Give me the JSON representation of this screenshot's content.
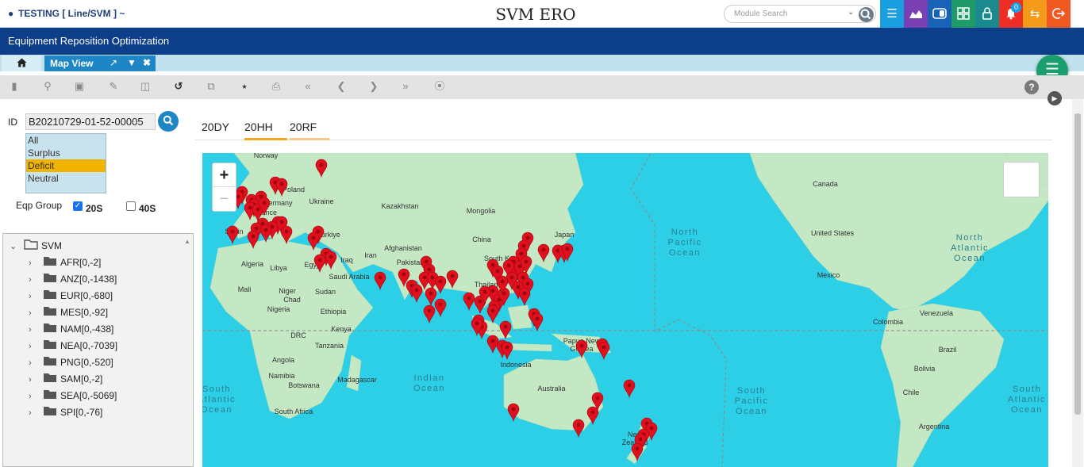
{
  "header": {
    "user_label": "TESTING [ Line/SVM ] ~",
    "app_title": "SVM ERO",
    "search_placeholder": "Module Search",
    "notification_count": "0"
  },
  "banner": {
    "title": "Equipment Reposition Optimization"
  },
  "tabs": {
    "active_label": "Map View"
  },
  "form": {
    "id_label": "ID",
    "id_value": "B20210729-01-52-00005",
    "status_options": [
      "All",
      "Surplus",
      "Deficit",
      "Neutral"
    ],
    "selected_status": "Deficit",
    "eqp_group_label": "Eqp Group",
    "eqp_options": [
      {
        "label": "20S",
        "checked": true
      },
      {
        "label": "40S",
        "checked": false
      }
    ]
  },
  "tree": {
    "root": "SVM",
    "children": [
      "AFR[0,-2]",
      "ANZ[0,-1438]",
      "EUR[0,-680]",
      "MES[0,-92]",
      "NAM[0,-438]",
      "NEA[0,-7039]",
      "PNG[0,-520]",
      "SAM[0,-2]",
      "SEA[0,-5069]",
      "SPI[0,-76]"
    ]
  },
  "map_tabs": [
    "20DY",
    "20HH",
    "20RF"
  ],
  "active_map_tab": "20HH",
  "map": {
    "zoom_in": "+",
    "zoom_out": "−",
    "labels": {
      "countries": [
        "Norway",
        "Poland",
        "Ukraine",
        "Kazakhstan",
        "Mongolia",
        "China",
        "Japan",
        "South Korea",
        "Afghanistan",
        "Pakistan",
        "Iran",
        "Iraq",
        "Türkiye",
        "Egypt",
        "Saudi Arabia",
        "Libya",
        "Algeria",
        "Mali",
        "Niger",
        "Chad",
        "Sudan",
        "Nigeria",
        "Ethiopia",
        "Kenya",
        "DRC",
        "Tanzania",
        "Angola",
        "Namibia",
        "Botswana",
        "South Africa",
        "Madagascar",
        "Thailand",
        "Indonesia",
        "Papua New Guinea",
        "Australia",
        "New Zealand",
        "France",
        "Germany",
        "Spain",
        "Canada",
        "United States",
        "Mexico",
        "Venezuela",
        "Colombia",
        "Brazil",
        "Bolivia",
        "Chile",
        "Argentina"
      ],
      "oceans": [
        "North Pacific Ocean",
        "North Atlantic Ocean",
        "Indian Ocean",
        "South Pacific Ocean",
        "South Atlantic Ocean"
      ]
    },
    "colors": {
      "water": "#2ccfe5",
      "land": "#c4e8c4",
      "marker": "#e0101e"
    }
  },
  "colors": {
    "brand_navy": "#0d3e8a",
    "tab_blue": "#1f86c6",
    "fab_green": "#1a9e6e",
    "selected_option": "#f0b400"
  }
}
